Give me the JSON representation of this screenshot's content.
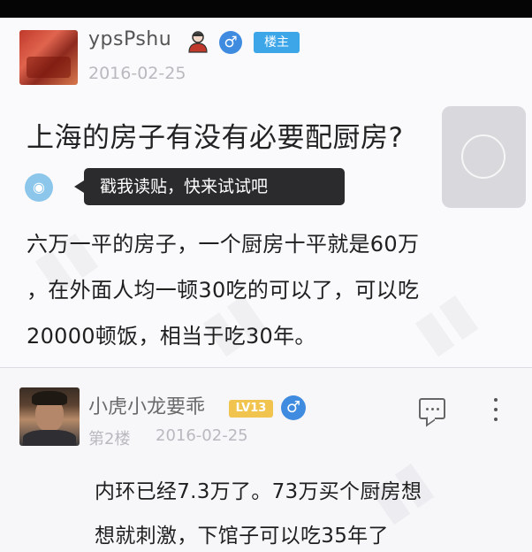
{
  "post": {
    "author": "ypsPshu",
    "owner_badge": "楼主",
    "gender_symbol": "♂",
    "date": "2016-02-25",
    "title": "上海的房子有没有必要配厨房?",
    "read_tip": "戳我读贴，快来试试吧",
    "body_lines": [
      "六万一平的房子，一个厨房十平就是60万",
      "，在外面人均一顿30吃的可以了，可以吃",
      "20000顿饭，相当于吃30年。"
    ]
  },
  "reply": {
    "author": "小虎小龙要乖",
    "level_badge": "LV13",
    "gender_symbol": "♂",
    "floor": "第2楼",
    "date": "2016-02-25",
    "body_lines": [
      "内环已经7.3万了。73万买个厨房想",
      "想就刺激，下馆子可以吃35年了"
    ]
  },
  "colors": {
    "male_badge": "#3f8be0",
    "owner_badge": "#3ca6e8",
    "level_badge": "#f0c44e",
    "tooltip_bg": "#2b2b2e"
  },
  "icons": {
    "user": "user-icon",
    "male": "male-icon",
    "read": "sound-wave-icon",
    "play": "play-icon",
    "comment": "comment-icon",
    "more": "more-vertical-icon"
  }
}
